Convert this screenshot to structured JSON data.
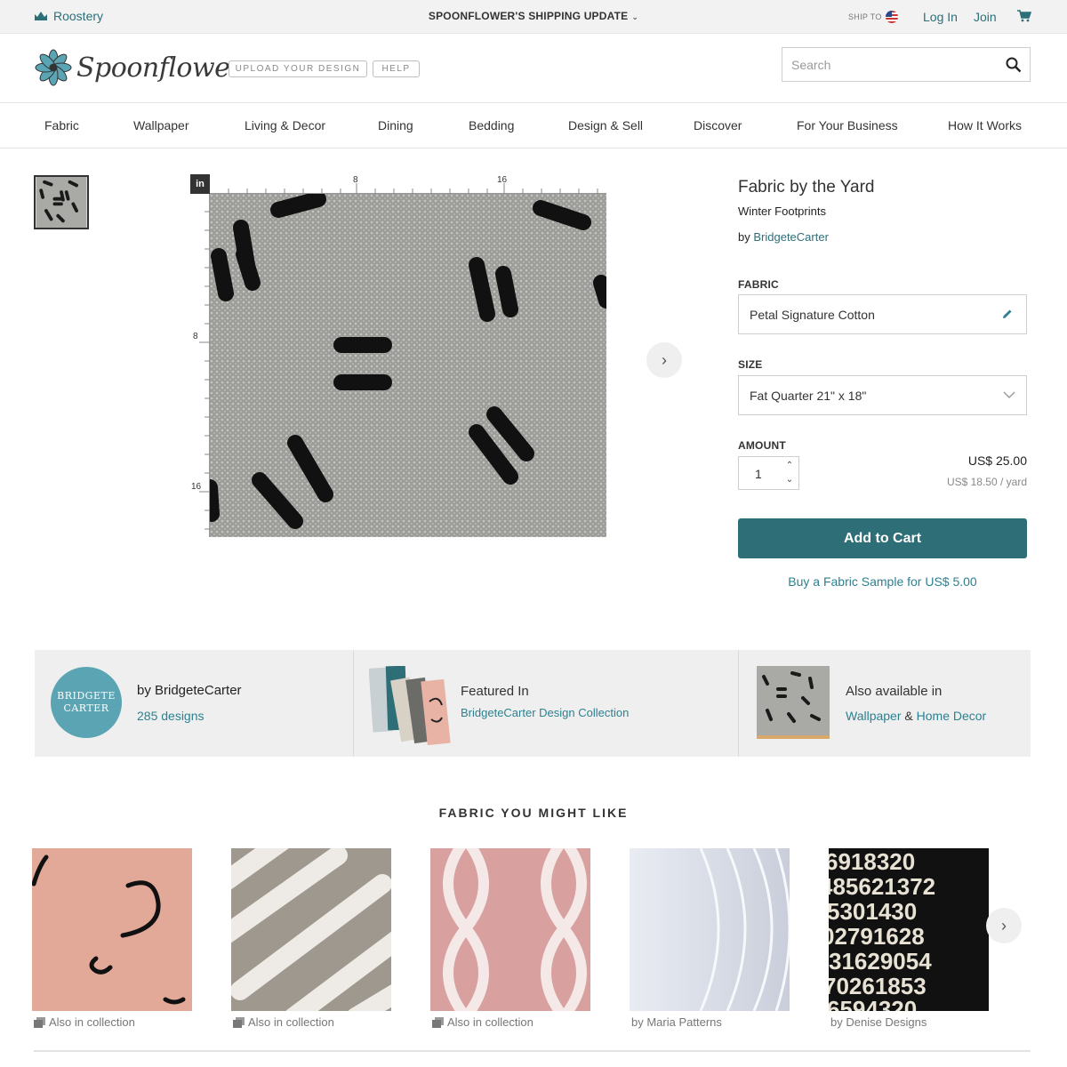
{
  "topbar": {
    "roostery_label": "Roostery",
    "shipping_update": "SPOONFLOWER'S SHIPPING UPDATE",
    "ship_to": "SHIP TO",
    "login": "Log In",
    "join": "Join"
  },
  "header": {
    "logo_text": "Spoonflower",
    "upload_label": "UPLOAD YOUR DESIGN",
    "help_label": "HELP",
    "search_placeholder": "Search"
  },
  "nav": [
    "Fabric",
    "Wallpaper",
    "Living & Decor",
    "Dining",
    "Bedding",
    "Design & Sell",
    "Discover",
    "For Your Business",
    "How It Works"
  ],
  "viewer": {
    "unit": "in",
    "ruler_marks": [
      "8",
      "16"
    ]
  },
  "product": {
    "title": "Fabric by the Yard",
    "design_name": "Winter Footprints",
    "by_prefix": "by",
    "designer": "BridgeteCarter",
    "fabric_label": "FABRIC",
    "fabric_value": "Petal Signature Cotton",
    "size_label": "SIZE",
    "size_value": "Fat Quarter 21\" x 18\"",
    "amount_label": "AMOUNT",
    "amount_value": "1",
    "price": "US$ 25.00",
    "unit_price": "US$ 18.50 / yard",
    "add_to_cart": "Add to Cart",
    "sample_link": "Buy a Fabric Sample for US$ 5.00"
  },
  "info_strip": {
    "avatar_text_1": "BRIDGETE",
    "avatar_text_2": "CARTER",
    "designer_label": "by BridgeteCarter",
    "designs_count": "285 designs",
    "featured_label": "Featured In",
    "featured_link": "BridgeteCarter Design Collection",
    "also_label": "Also available in",
    "also_link_1": "Wallpaper",
    "also_amp": "&",
    "also_link_2": "Home Decor"
  },
  "recommendations": {
    "title": "FABRIC YOU MIGHT LIKE",
    "items": [
      {
        "caption": "Also in collection",
        "collection": true
      },
      {
        "caption": "Also in collection",
        "collection": true
      },
      {
        "caption": "Also in collection",
        "collection": true
      },
      {
        "caption": "by Maria Patterns",
        "collection": false
      },
      {
        "caption": "by Denise Designs",
        "collection": false
      }
    ]
  },
  "colors": {
    "accent": "#2e6e76",
    "link": "#2c8190",
    "strip_bg": "#efefef",
    "avatar": "#5aa4b3"
  }
}
